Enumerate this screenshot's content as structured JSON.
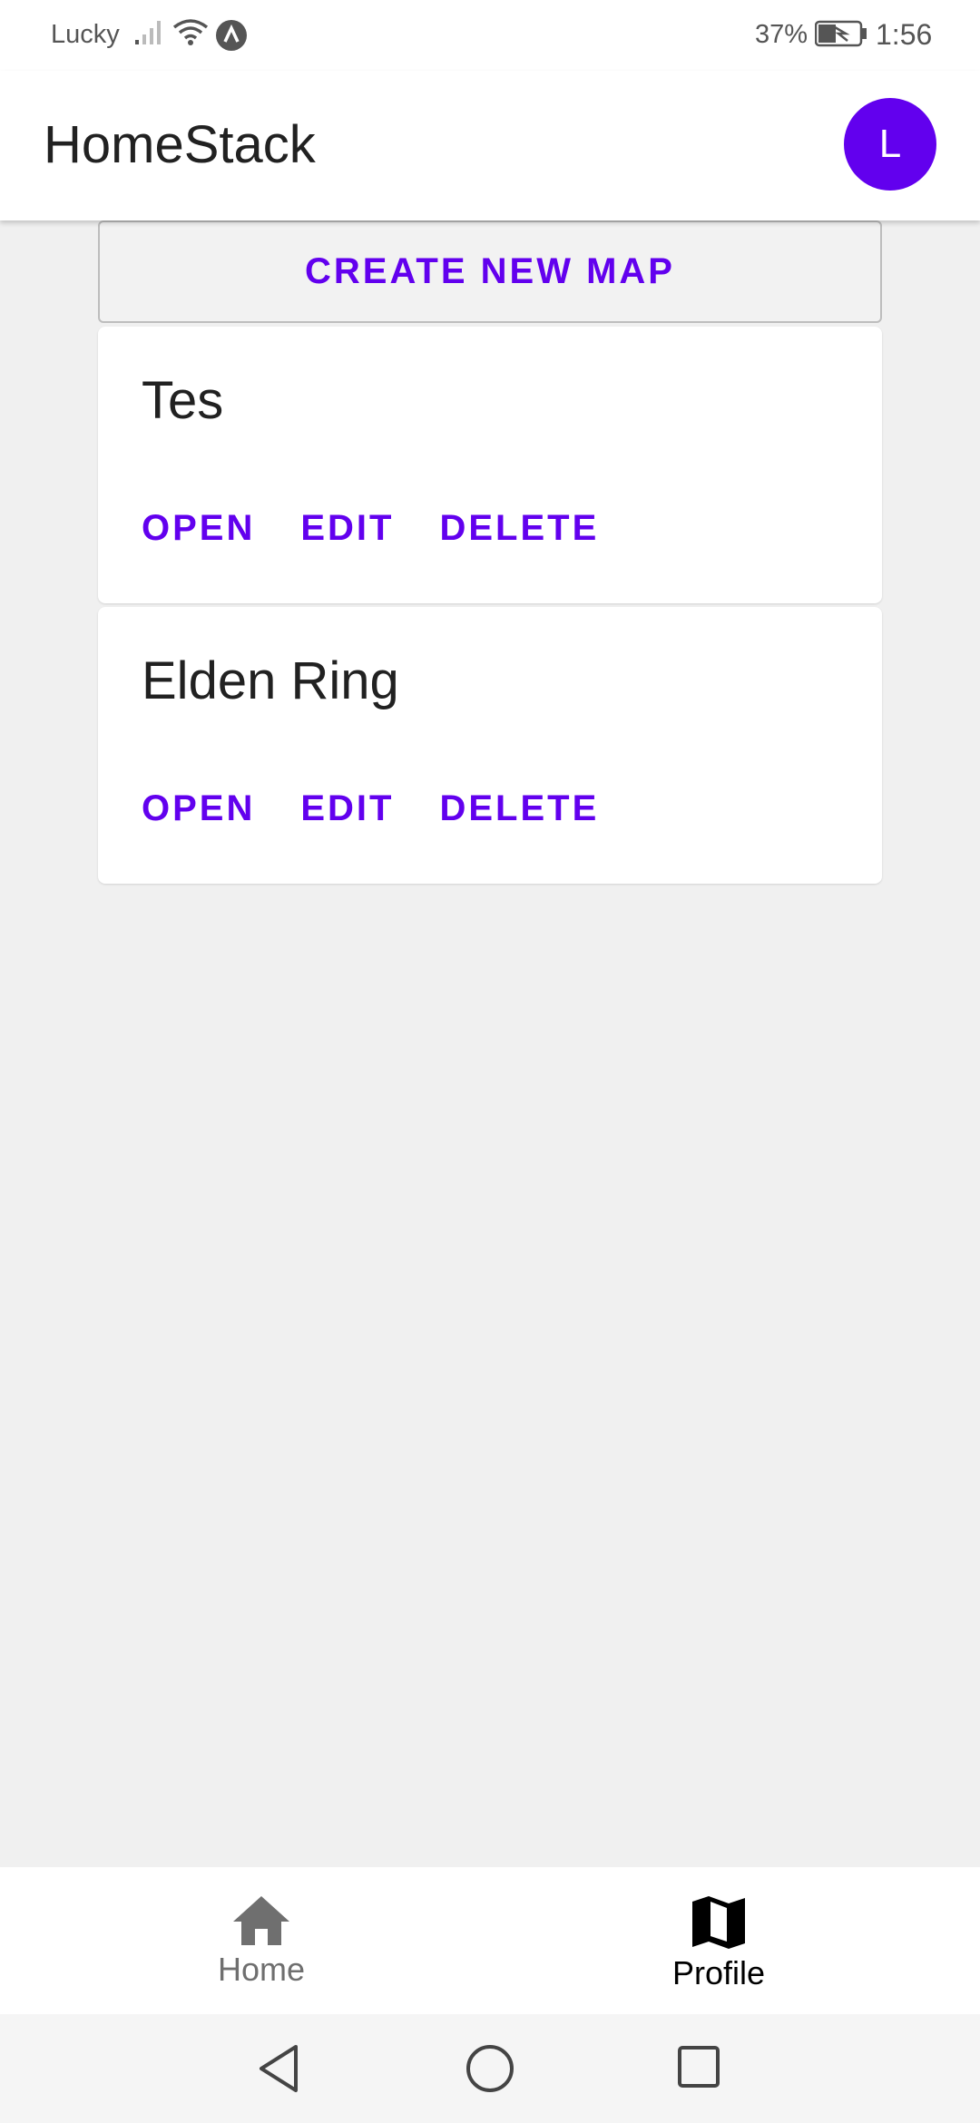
{
  "status_bar": {
    "carrier": "Lucky",
    "battery_percent": "37%",
    "time": "1:56",
    "icons": [
      "signal-icon",
      "wifi-icon",
      "nfc-icon",
      "battery-charging-icon"
    ]
  },
  "app_bar": {
    "title": "HomeStack",
    "avatar_initial": "L"
  },
  "create_button_label": "CREATE NEW MAP",
  "maps": [
    {
      "title": "Tes",
      "actions": [
        "OPEN",
        "EDIT",
        "DELETE"
      ]
    },
    {
      "title": "Elden Ring",
      "actions": [
        "OPEN",
        "EDIT",
        "DELETE"
      ]
    }
  ],
  "bottom_nav": {
    "items": [
      {
        "label": "Home",
        "icon": "home-icon",
        "active": false
      },
      {
        "label": "Profile",
        "icon": "map-icon",
        "active": true
      }
    ]
  },
  "system_nav": [
    "back-icon",
    "home-circle-icon",
    "recent-apps-icon"
  ],
  "colors": {
    "accent": "#6200ee",
    "background": "#f0f0f0",
    "surface": "#ffffff",
    "text_primary": "#212121",
    "nav_inactive": "#6f6f6f"
  }
}
